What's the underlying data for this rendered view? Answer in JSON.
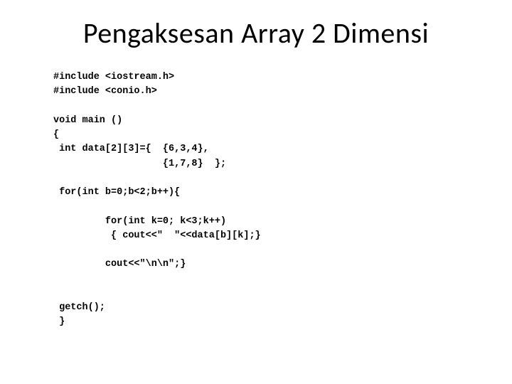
{
  "title": "Pengaksesan Array 2 Dimensi",
  "code_lines": {
    "l1": "#include <iostream.h>",
    "l2": "#include <conio.h>",
    "l3": "",
    "l4": "void main ()",
    "l5": "{",
    "l6": " int data[2][3]={  {6,3,4},",
    "l7": "                   {1,7,8}  };",
    "l8": "",
    "l9": " for(int b=0;b<2;b++){",
    "l10": "",
    "l11": "         for(int k=0; k<3;k++)",
    "l12": "          { cout<<\"  \"<<data[b][k];}",
    "l13": "",
    "l14": "         cout<<\"\\n\\n\";}",
    "l15": "",
    "l16": "",
    "l17": " getch();",
    "l18": " }"
  }
}
